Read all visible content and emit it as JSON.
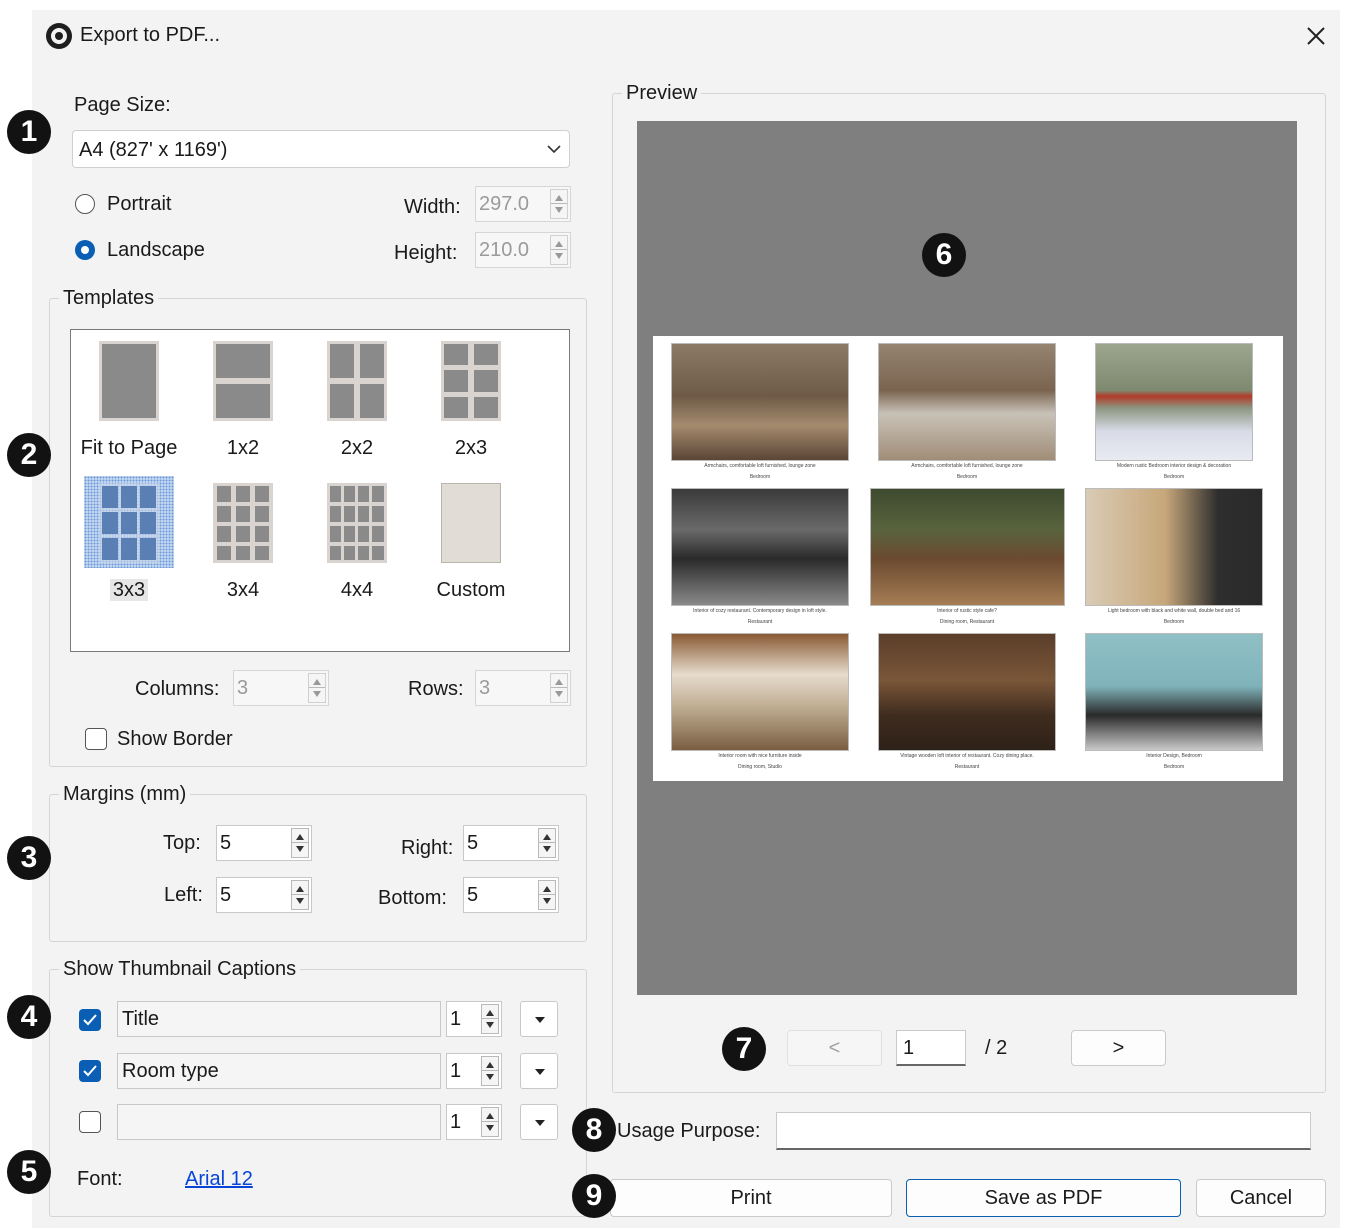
{
  "window": {
    "title": "Export to PDF...",
    "close_icon": "close-icon"
  },
  "page_size": {
    "label": "Page Size:",
    "selected": "A4 (827' x 1169')",
    "orientation": {
      "portrait": "Portrait",
      "landscape": "Landscape",
      "selected": "Landscape"
    },
    "width_label": "Width:",
    "width_value": "297.0",
    "height_label": "Height:",
    "height_value": "210.0"
  },
  "templates": {
    "title": "Templates",
    "items": [
      {
        "name": "Fit to Page",
        "icon": "fit-to-page-icon"
      },
      {
        "name": "1x2",
        "icon": "layout-1x2-icon"
      },
      {
        "name": "2x2",
        "icon": "layout-2x2-icon"
      },
      {
        "name": "2x3",
        "icon": "layout-2x3-icon"
      },
      {
        "name": "3x3",
        "icon": "layout-3x3-icon"
      },
      {
        "name": "3x4",
        "icon": "layout-3x4-icon"
      },
      {
        "name": "4x4",
        "icon": "layout-4x4-icon"
      },
      {
        "name": "Custom",
        "icon": "custom-layout-icon"
      }
    ],
    "selected": "3x3",
    "columns_label": "Columns:",
    "columns_value": "3",
    "rows_label": "Rows:",
    "rows_value": "3",
    "show_border_label": "Show Border",
    "show_border": false
  },
  "margins": {
    "title": "Margins (mm)",
    "top_label": "Top:",
    "top": "5",
    "left_label": "Left:",
    "left": "5",
    "right_label": "Right:",
    "right": "5",
    "bottom_label": "Bottom:",
    "bottom": "5"
  },
  "captions": {
    "title": "Show Thumbnail Captions",
    "rows": [
      {
        "checked": true,
        "field": "Title",
        "lines": "1"
      },
      {
        "checked": true,
        "field": "Room type",
        "lines": "1"
      },
      {
        "checked": false,
        "field": "",
        "lines": "1"
      }
    ],
    "font_label": "Font:",
    "font_value": "Arial 12"
  },
  "preview": {
    "title": "Preview",
    "thumbnails": [
      {
        "caption": "Armchairs, comfortable loft furnished, lounge zone",
        "room": "Bedroom"
      },
      {
        "caption": "Armchairs, comfortable loft furnished, lounge zone",
        "room": "Bedroom"
      },
      {
        "caption": "Modern rustic Bedroom interior design & decoration",
        "room": "Bedroom"
      },
      {
        "caption": "Interior of cozy restaurant. Contemporary design in loft style.",
        "room": "Restaurant"
      },
      {
        "caption": "Interior of rustic style cafe?",
        "room": "Dining room, Restaurant"
      },
      {
        "caption": "Light bedroom with black and white wall, double bed and 16",
        "room": "Bedroom"
      },
      {
        "caption": "Interior room with nice furniture inside",
        "room": "Dining room, Studio"
      },
      {
        "caption": "Vintage wooden loft interior of restaurant. Cozy dining place.",
        "room": "Restaurant"
      },
      {
        "caption": "Interior Design, Bedroom",
        "room": "Bedroom"
      }
    ],
    "prev_label": "<",
    "next_label": ">",
    "page": "1",
    "total": "/ 2"
  },
  "usage": {
    "label": "Usage Purpose:",
    "value": ""
  },
  "buttons": {
    "print": "Print",
    "save": "Save as PDF",
    "cancel": "Cancel"
  },
  "markers": [
    "1",
    "2",
    "3",
    "4",
    "5",
    "6",
    "7",
    "8",
    "9"
  ],
  "colors": {
    "accent": "#0a5fb4",
    "preview_bg": "#7f7f7f",
    "link": "#0645d8"
  }
}
